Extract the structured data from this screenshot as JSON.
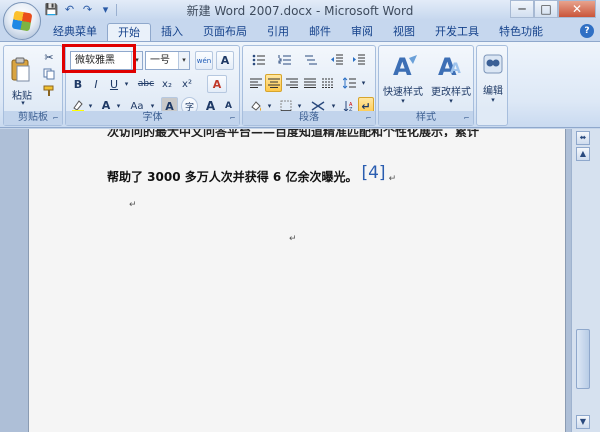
{
  "titlebar": {
    "title": "新建 Word 2007.docx - Microsoft Word",
    "qat": {
      "save": "💾",
      "undo": "↶",
      "redo": "↷",
      "more": "▾"
    },
    "window_buttons": {
      "minimize": "─",
      "maximize": "□",
      "close": "✕"
    }
  },
  "tabs": [
    {
      "label": "经典菜单",
      "active": false
    },
    {
      "label": "开始",
      "active": true
    },
    {
      "label": "插入",
      "active": false
    },
    {
      "label": "页面布局",
      "active": false
    },
    {
      "label": "引用",
      "active": false
    },
    {
      "label": "邮件",
      "active": false
    },
    {
      "label": "审阅",
      "active": false
    },
    {
      "label": "视图",
      "active": false
    },
    {
      "label": "开发工具",
      "active": false
    },
    {
      "label": "特色功能",
      "active": false
    }
  ],
  "help_label": "?",
  "ribbon": {
    "clipboard": {
      "paste_label": "粘贴",
      "group_label": "剪贴板",
      "launcher": "⌐"
    },
    "font": {
      "font_name": "微软雅黑",
      "font_size": "一号",
      "group_label": "字体",
      "launcher": "⌐",
      "wen": "wén",
      "A_box": "A",
      "bold": "B",
      "italic": "I",
      "underline": "U",
      "strike": "abc",
      "sub": "x₂",
      "sup": "x²",
      "clear": "A",
      "aa": "Aa",
      "char_shade": "A",
      "enclose": "字",
      "grow": "A",
      "shrink": "A",
      "dropdown": "▾"
    },
    "paragraph": {
      "group_label": "段落",
      "launcher": "⌐"
    },
    "styles": {
      "quick_label": "快速样式",
      "change_label": "更改样式",
      "group_label": "样式",
      "launcher": "⌐"
    },
    "editing": {
      "label": "编辑"
    }
  },
  "accent": {
    "red_outline": "#e00000",
    "reference_blue": "#2a5db0"
  },
  "document": {
    "line_partial": "次访问的最大中文问答平台——百度知道精准匹配和个性化展示，累计",
    "line2": "帮助了 3000 多万人次并获得 6 亿余次曝光。",
    "reference": "[4]",
    "para_mark": "↵"
  },
  "scroll": {
    "up": "▲",
    "down": "▼",
    "split": "⬌"
  }
}
